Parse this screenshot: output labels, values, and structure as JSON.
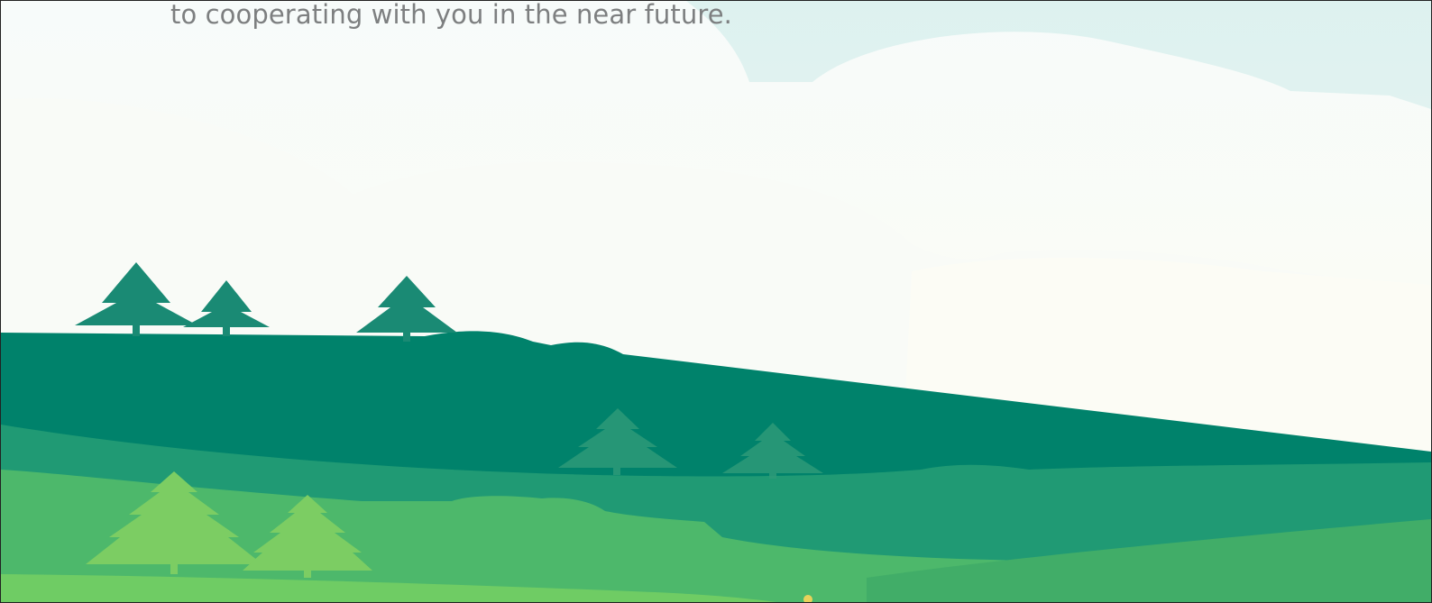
{
  "text": {
    "caption": "to cooperating with you in the near future."
  },
  "colors": {
    "sky": "#e6f4f3",
    "cloud": "#f8fbf8",
    "dark_hill": "#00826b",
    "tree_dark": "#1a8a74",
    "mid_hill": "#209a74",
    "light_hill": "#4db86b",
    "front_grass": "#6fcc64",
    "tree_light": "#7ccd63",
    "caption_text": "#7d7f80"
  },
  "icons": [
    "tree-icon"
  ]
}
